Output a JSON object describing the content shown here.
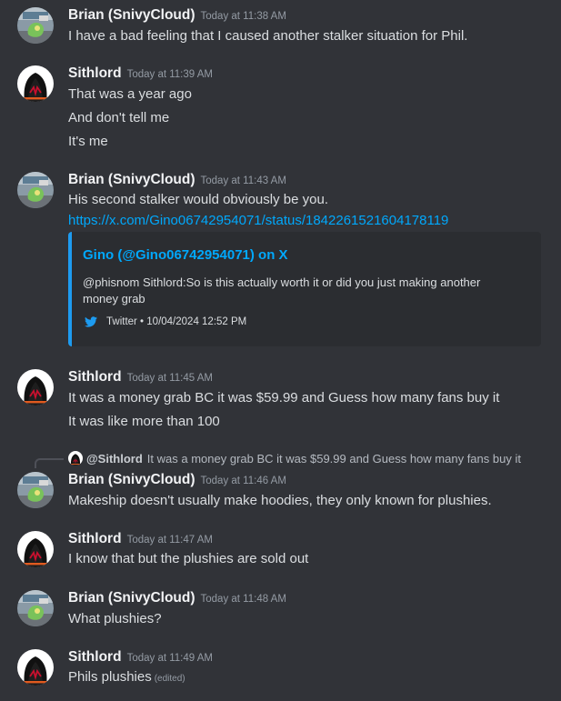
{
  "users": {
    "brian": "Brian (SnivyCloud)",
    "sith": "Sithlord"
  },
  "messages": [
    {
      "ts": "Today at 11:38 AM",
      "lines": [
        "I have a bad feeling that I caused another stalker situation for Phil."
      ]
    },
    {
      "ts": "Today at 11:39 AM",
      "lines": [
        "That was a year ago",
        "And don't tell me",
        "It's me"
      ]
    },
    {
      "ts": "Today at 11:43 AM",
      "lines": [
        "His second stalker would obviously be you."
      ],
      "link": "https://x.com/Gino06742954071/status/1842261521604178119"
    },
    {
      "ts": "Today at 11:45 AM",
      "lines": [
        "It was a money grab BC it was $59.99 and Guess how many fans buy it",
        "It was like more than 100"
      ]
    },
    {
      "ts": "Today at 11:46 AM",
      "lines": [
        "Makeship doesn't usually make hoodies, they only known for plushies."
      ]
    },
    {
      "ts": "Today at 11:47 AM",
      "lines": [
        "I know that but the plushies are sold out"
      ]
    },
    {
      "ts": "Today at 11:48 AM",
      "lines": [
        "What plushies?"
      ]
    },
    {
      "ts": "Today at 11:49 AM",
      "lines": [
        "Phils plushies"
      ],
      "edited": "(edited)"
    }
  ],
  "embed": {
    "title": "Gino (@Gino06742954071) on X",
    "description": "@phisnom Sithlord:So is this actually worth it or did you just making another money grab",
    "footer": "Twitter • 10/04/2024 12:52 PM",
    "accent": "#1d9bf0"
  },
  "reply": {
    "name": "@Sithlord",
    "text": "It was a money grab BC it was $59.99 and Guess how many fans buy it"
  },
  "colors": {
    "background": "#313338",
    "link": "#00a8fc",
    "timestamp": "#949ba4"
  }
}
